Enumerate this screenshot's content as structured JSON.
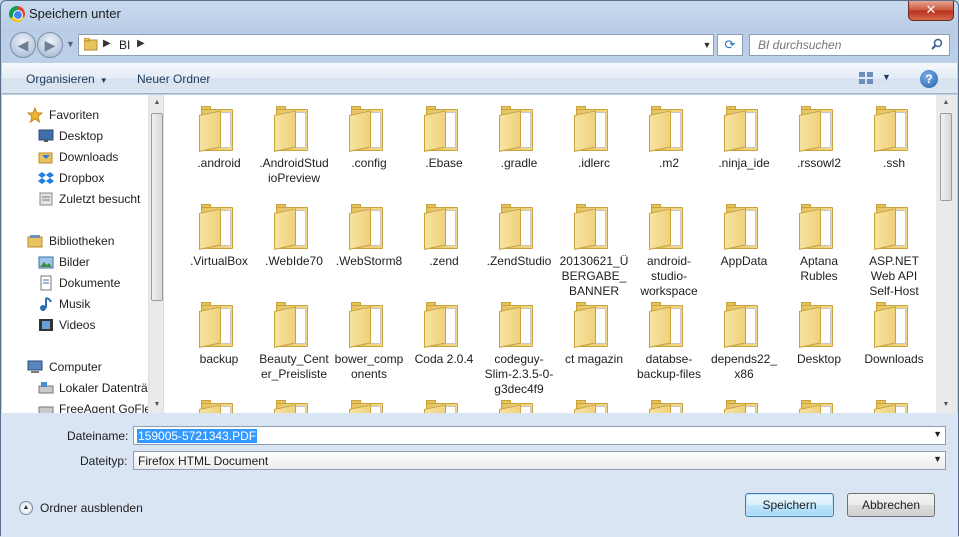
{
  "window": {
    "title": "Speichern unter",
    "close_label": "✕"
  },
  "address": {
    "path": [
      "BI"
    ],
    "search_placeholder": "BI durchsuchen"
  },
  "toolbar": {
    "organize_label": "Organisieren",
    "new_folder_label": "Neuer Ordner",
    "help_label": "?"
  },
  "nav": {
    "items": [
      {
        "label": "Favoriten",
        "icon": "star-icon"
      },
      {
        "label": "Desktop",
        "icon": "desktop-icon"
      },
      {
        "label": "Downloads",
        "icon": "downloads-icon"
      },
      {
        "label": "Dropbox",
        "icon": "dropbox-icon"
      },
      {
        "label": "Zuletzt besucht",
        "icon": "recent-icon"
      },
      {
        "label": "Bibliotheken",
        "icon": "libraries-icon"
      },
      {
        "label": "Bilder",
        "icon": "pictures-icon"
      },
      {
        "label": "Dokumente",
        "icon": "documents-icon"
      },
      {
        "label": "Musik",
        "icon": "music-icon"
      },
      {
        "label": "Videos",
        "icon": "videos-icon"
      },
      {
        "label": "Computer",
        "icon": "computer-icon"
      },
      {
        "label": "Lokaler Datenträger",
        "icon": "drive-icon"
      },
      {
        "label": "FreeAgent GoFlex",
        "icon": "drive-icon"
      }
    ]
  },
  "files": [
    {
      "name": ".android"
    },
    {
      "name": ".AndroidStudioPreview"
    },
    {
      "name": ".config"
    },
    {
      "name": ".Ebase"
    },
    {
      "name": ".gradle"
    },
    {
      "name": ".idlerc"
    },
    {
      "name": ".m2"
    },
    {
      "name": ".ninja_ide"
    },
    {
      "name": ".rssowl2"
    },
    {
      "name": ".ssh"
    },
    {
      "name": ".VirtualBox"
    },
    {
      "name": ".WebIde70"
    },
    {
      "name": ".WebStorm8"
    },
    {
      "name": ".zend"
    },
    {
      "name": ".ZendStudio"
    },
    {
      "name": "20130621_ÜBERGABE_BANNER"
    },
    {
      "name": "android-studio-workspace"
    },
    {
      "name": "AppData"
    },
    {
      "name": "Aptana Rubles"
    },
    {
      "name": "ASP.NET Web API Self-Host"
    },
    {
      "name": "backup"
    },
    {
      "name": "Beauty_Center_Preisliste"
    },
    {
      "name": "bower_components"
    },
    {
      "name": "Coda 2.0.4"
    },
    {
      "name": "codeguy-Slim-2.3.5-0-g3dec4f9"
    },
    {
      "name": "ct magazin"
    },
    {
      "name": "databse-backup-files"
    },
    {
      "name": "depends22_x86"
    },
    {
      "name": "Desktop"
    },
    {
      "name": "Downloads"
    },
    {
      "name": ""
    },
    {
      "name": ""
    },
    {
      "name": ""
    },
    {
      "name": ""
    },
    {
      "name": ""
    },
    {
      "name": ""
    },
    {
      "name": ""
    },
    {
      "name": ""
    },
    {
      "name": ""
    },
    {
      "name": ""
    }
  ],
  "form": {
    "filename_label": "Dateiname:",
    "filename_value": "159005-5721343.PDF",
    "filetype_label": "Dateityp:",
    "filetype_value": "Firefox HTML Document",
    "save_label": "Speichern",
    "cancel_label": "Abbrechen",
    "hide_folders_label": "Ordner ausblenden"
  }
}
